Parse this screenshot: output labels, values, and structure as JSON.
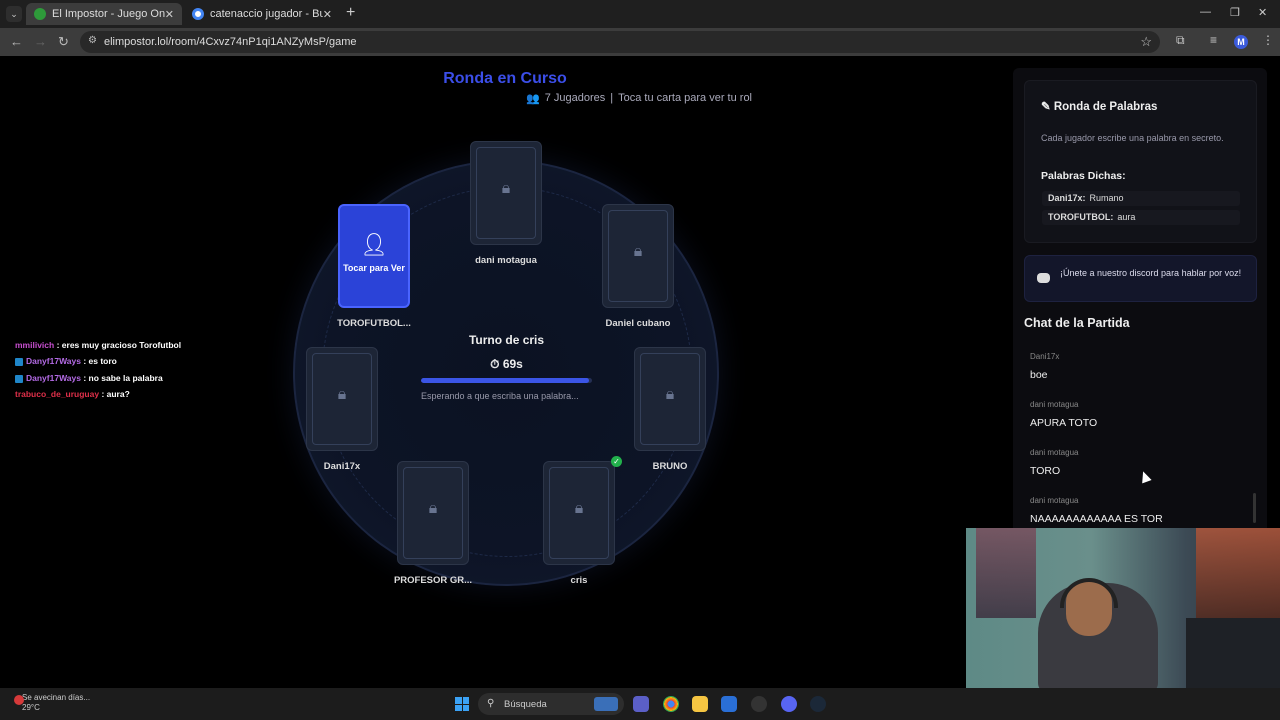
{
  "browser": {
    "tabs": [
      {
        "title": "El Impostor - Juego Online Gra",
        "active": true
      },
      {
        "title": "catenaccio jugador - Buscar co",
        "active": false
      }
    ],
    "url": "elimpostor.lol/room/4Cxvz74nP1qi1ANZyMsP/game",
    "profile_initial": "M"
  },
  "game": {
    "title": "Ronda en Curso",
    "player_count": "7 Jugadores",
    "subtitle_sep": "|",
    "subtitle_hint": "Toca tu carta para ver tu rol",
    "turn_label": "Turno de cris",
    "timer": "69s",
    "progress": 0.98,
    "waiting_text": "Esperando a que escriba una palabra...",
    "tap_card_label": "Tocar para Ver",
    "players": [
      {
        "name": "dani motagua"
      },
      {
        "name": "Daniel cubano"
      },
      {
        "name": "BRUNO"
      },
      {
        "name": "cris"
      },
      {
        "name": "PROFESOR GR..."
      },
      {
        "name": "Dani17x"
      },
      {
        "name": "TOROFUTBOL..."
      }
    ]
  },
  "stream_chat": [
    {
      "user": "mmilivich",
      "text": "eres muy gracioso Torofutbol",
      "color": "#c84fd0"
    },
    {
      "user": "Danyf17Ways",
      "text": "es toro",
      "color": "#b46be6"
    },
    {
      "user": "Danyf17Ways",
      "text": "no sabe la palabra",
      "color": "#b46be6"
    },
    {
      "user": "trabuco_de_uruguay",
      "text": "aura?",
      "color": "#e0304a"
    }
  ],
  "words_panel": {
    "title": "Ronda de Palabras",
    "description": "Cada jugador escribe una palabra en secreto.",
    "said_title": "Palabras Dichas:",
    "words": [
      {
        "player": "Dani17x:",
        "word": "Rumano"
      },
      {
        "player": "TOROFUTBOL:",
        "word": "aura"
      }
    ]
  },
  "discord": {
    "text": "¡Únete a nuestro discord para hablar por voz!"
  },
  "chat": {
    "title": "Chat de la Partida",
    "messages": [
      {
        "author": "Dani17x",
        "text": "boe"
      },
      {
        "author": "dani motagua",
        "text": "APURA TOTO"
      },
      {
        "author": "dani motagua",
        "text": "TORO"
      },
      {
        "author": "dani motagua",
        "text": "NAAAAAAAAAAAA ES TOR"
      }
    ]
  },
  "taskbar": {
    "weather_text": "Se avecinan días...",
    "temperature": "29°C",
    "search_placeholder": "Búsqueda"
  }
}
